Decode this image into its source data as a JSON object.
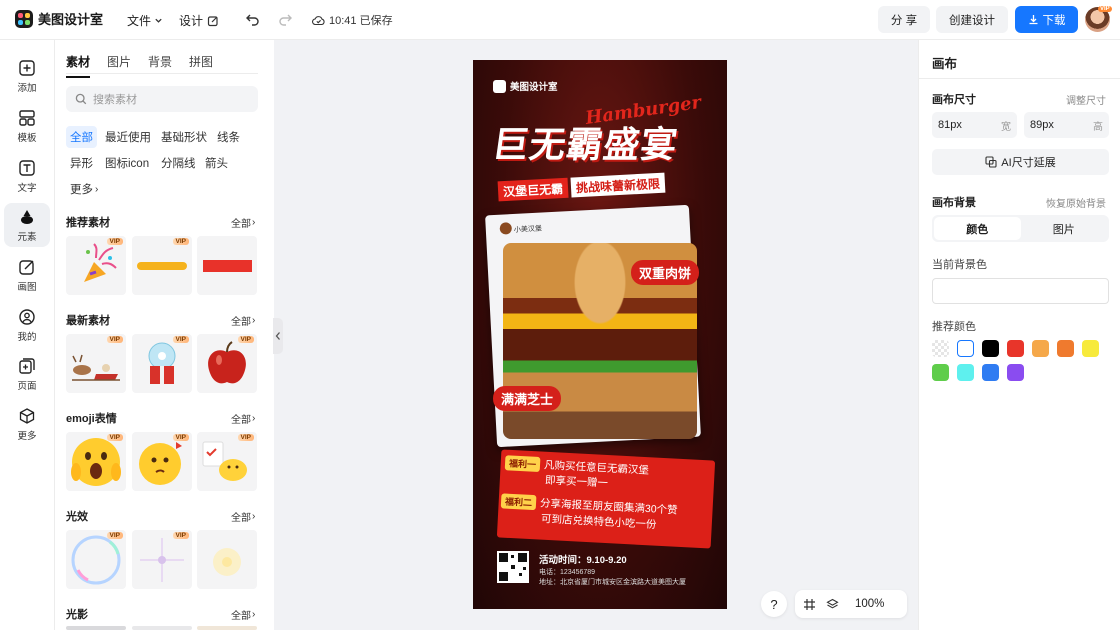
{
  "app": {
    "name": "美图设计室",
    "saved_time": "10:41 已保存"
  },
  "topbar": {
    "file_menu": "文件",
    "design_menu": "设计",
    "share": "分 享",
    "create_design": "创建设计",
    "download": "下载",
    "avatar_badge": "VIP"
  },
  "leftnav": {
    "items": [
      {
        "label": "添加",
        "icon": "plus-square-icon"
      },
      {
        "label": "模板",
        "icon": "template-icon"
      },
      {
        "label": "文字",
        "icon": "text-icon"
      },
      {
        "label": "元素",
        "icon": "shapes-icon",
        "active": true
      },
      {
        "label": "画图",
        "icon": "draw-icon"
      },
      {
        "label": "我的",
        "icon": "user-icon"
      },
      {
        "label": "页面",
        "icon": "page-add-icon"
      },
      {
        "label": "更多",
        "icon": "cube-icon"
      }
    ]
  },
  "panel": {
    "tabs": [
      "素材",
      "图片",
      "背景",
      "拼图"
    ],
    "search_placeholder": "搜索素材",
    "chips": [
      "全部",
      "最近使用",
      "基础形状",
      "线条",
      "异形",
      "图标icon",
      "分隔线",
      "箭头",
      "更多"
    ],
    "see_all": "全部",
    "vip_label": "VIP",
    "sections": [
      {
        "title": "推荐素材",
        "items": [
          "party-popper",
          "yellow-brush-stroke",
          "red-bar"
        ],
        "vip": [
          true,
          true,
          false
        ]
      },
      {
        "title": "最新素材",
        "items": [
          "reindeer-sleigh",
          "snow-globe-gift",
          "red-apple"
        ],
        "vip": [
          true,
          true,
          true
        ]
      },
      {
        "title": "emoji表情",
        "items": [
          "shocked-emoji",
          "thinking-emoji",
          "chick-checklist"
        ],
        "vip": [
          true,
          true,
          true
        ]
      },
      {
        "title": "光效",
        "items": [
          "bubble-ring",
          "purple-sparkle",
          "soft-glow"
        ],
        "vip": [
          true,
          true,
          false
        ]
      },
      {
        "title": "光影"
      }
    ]
  },
  "poster": {
    "brand": "美图设计室",
    "english_title": "Hamburger",
    "title": "巨无霸盛宴",
    "subtitle_a": "汉堡巨无霸",
    "subtitle_b": "挑战味蕾新极限",
    "card_user": "小美汉堡",
    "tag_patty": "双重肉饼",
    "tag_cheese": "满满芝士",
    "bonus1_label": "福利一",
    "bonus1_text": "凡购买任意巨无霸汉堡",
    "bonus1_text2": "即享买一赠一",
    "bonus2_label": "福利二",
    "bonus2_text": "分享海报至朋友圈集满30个赞",
    "bonus2_text2": "可到店兑换特色小吃一份",
    "time": "活动时间：9.10-9.20",
    "phone": "电话：123456789",
    "address": "地址：北京省厦门市城安区金滨路大道美图大厦"
  },
  "canvas_controls": {
    "help": "?",
    "zoom": "100%"
  },
  "right": {
    "title": "画布",
    "size_label": "画布尺寸",
    "size_adjust": "调整尺寸",
    "width_value": "81px",
    "width_unit": "宽",
    "height_value": "89px",
    "height_unit": "高",
    "ai_expand": "AI尺寸延展",
    "bg_label": "画布背景",
    "bg_restore": "恢复原始背景",
    "bg_color_tab": "颜色",
    "bg_image_tab": "图片",
    "current_bg_label": "当前背景色",
    "current_bg_color": "#ffffff",
    "recommend_label": "推荐颜色",
    "swatches": [
      "transparent",
      "#ffffff",
      "#000000",
      "#e8352a",
      "#f5a84a",
      "#ef7a2e",
      "#f7ea3c",
      "#5fcd4b",
      "#5ef0ee",
      "#2f7cf2",
      "#8a4cf0"
    ]
  },
  "colors": {
    "accent": "#1677ff",
    "chip_active_bg": "#e8f1ff"
  }
}
